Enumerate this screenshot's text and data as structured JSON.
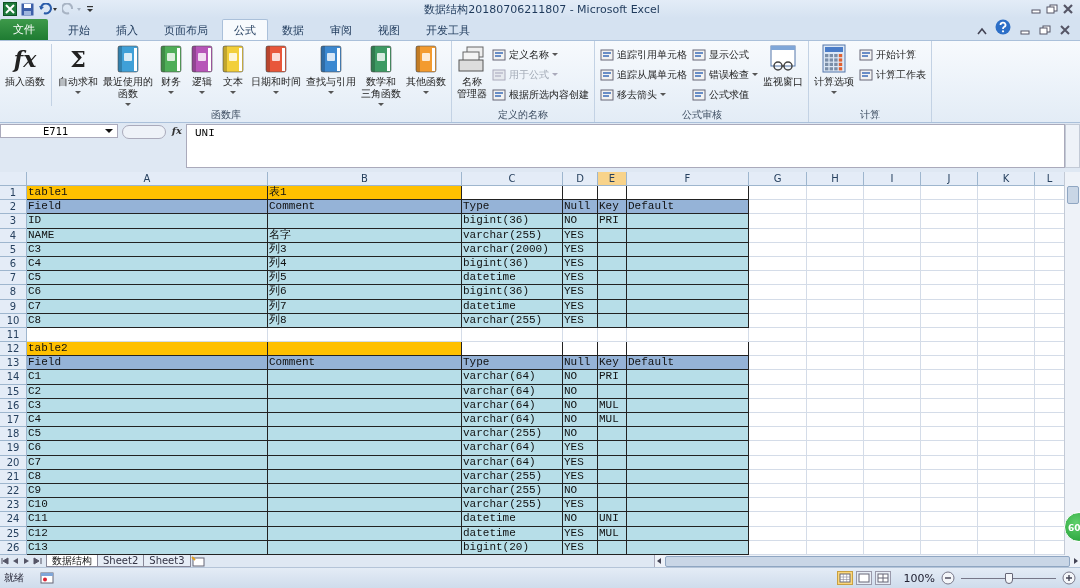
{
  "window": {
    "title": "数据结构20180706211807 - Microsoft Excel"
  },
  "tabs": [
    {
      "label": "文件",
      "kind": "file",
      "selected": false
    },
    {
      "label": "开始",
      "kind": "tab",
      "selected": false
    },
    {
      "label": "插入",
      "kind": "tab",
      "selected": false
    },
    {
      "label": "页面布局",
      "kind": "tab",
      "selected": false
    },
    {
      "label": "公式",
      "kind": "tab",
      "selected": true
    },
    {
      "label": "数据",
      "kind": "tab",
      "selected": false
    },
    {
      "label": "审阅",
      "kind": "tab",
      "selected": false
    },
    {
      "label": "视图",
      "kind": "tab",
      "selected": false
    },
    {
      "label": "开发工具",
      "kind": "tab",
      "selected": false
    }
  ],
  "ribbon": {
    "groups": [
      {
        "label": "函数库",
        "items": [
          {
            "kind": "big",
            "lines": [
              "插入函数"
            ],
            "glyph": "fx",
            "dropdown": false,
            "separator_after": true
          },
          {
            "kind": "big",
            "lines": [
              "自动求和"
            ],
            "glyph": "Σ",
            "dropdown": true
          },
          {
            "kind": "big",
            "lines": [
              "最近使用的",
              "函数"
            ],
            "dropdown": true
          },
          {
            "kind": "big",
            "lines": [
              "财务"
            ],
            "dropdown": true
          },
          {
            "kind": "big",
            "lines": [
              "逻辑"
            ],
            "dropdown": true
          },
          {
            "kind": "big",
            "lines": [
              "文本"
            ],
            "dropdown": true
          },
          {
            "kind": "big",
            "lines": [
              "日期和时间"
            ],
            "dropdown": true
          },
          {
            "kind": "big",
            "lines": [
              "查找与引用"
            ],
            "dropdown": true
          },
          {
            "kind": "big",
            "lines": [
              "数学和",
              "三角函数"
            ],
            "dropdown": true
          },
          {
            "kind": "big",
            "lines": [
              "其他函数"
            ],
            "dropdown": true
          }
        ]
      },
      {
        "label": "定义的名称",
        "items": [
          {
            "kind": "big",
            "lines": [
              "名称",
              "管理器"
            ],
            "dropdown": false
          },
          {
            "kind": "stack",
            "entries": [
              {
                "label": "定义名称",
                "dropdown": true,
                "disabled": false
              },
              {
                "label": "用于公式",
                "dropdown": true,
                "disabled": true
              },
              {
                "label": "根据所选内容创建",
                "dropdown": false,
                "disabled": false
              }
            ]
          }
        ]
      },
      {
        "label": "公式审核",
        "items": [
          {
            "kind": "stack",
            "entries": [
              {
                "label": "追踪引用单元格",
                "dropdown": false,
                "disabled": false
              },
              {
                "label": "追踪从属单元格",
                "dropdown": false,
                "disabled": false
              },
              {
                "label": "移去箭头",
                "dropdown": true,
                "disabled": false
              }
            ]
          },
          {
            "kind": "stack",
            "entries": [
              {
                "label": "显示公式",
                "dropdown": false,
                "disabled": false
              },
              {
                "label": "错误检查",
                "dropdown": true,
                "disabled": false
              },
              {
                "label": "公式求值",
                "dropdown": false,
                "disabled": false
              }
            ]
          },
          {
            "kind": "big",
            "lines": [
              "监视窗口"
            ],
            "dropdown": false
          }
        ]
      },
      {
        "label": "计算",
        "items": [
          {
            "kind": "big",
            "lines": [
              "计算选项"
            ],
            "dropdown": true
          },
          {
            "kind": "stack",
            "entries": [
              {
                "label": "开始计算",
                "dropdown": false,
                "disabled": false
              },
              {
                "label": "计算工作表",
                "dropdown": false,
                "disabled": false
              }
            ]
          }
        ]
      }
    ]
  },
  "formula_bar": {
    "name_box": "E711",
    "fx_label": "fx",
    "value": "UNI"
  },
  "sheet": {
    "columns": [
      {
        "letter": "A",
        "selected": false
      },
      {
        "letter": "B",
        "selected": false
      },
      {
        "letter": "C",
        "selected": false
      },
      {
        "letter": "D",
        "selected": false
      },
      {
        "letter": "E",
        "selected": true
      },
      {
        "letter": "F",
        "selected": false
      },
      {
        "letter": "G",
        "selected": false
      },
      {
        "letter": "H",
        "selected": false
      },
      {
        "letter": "I",
        "selected": false
      },
      {
        "letter": "J",
        "selected": false
      },
      {
        "letter": "K",
        "selected": false
      },
      {
        "letter": "L",
        "selected": false
      }
    ],
    "rows": [
      {
        "num": "1",
        "kind": "title",
        "cells": {
          "A": "table1",
          "B": "表1"
        }
      },
      {
        "num": "2",
        "kind": "header",
        "cells": {
          "A": "Field",
          "B": "Comment",
          "C": "Type",
          "D": "Null",
          "E": "Key",
          "F": "Default"
        }
      },
      {
        "num": "3",
        "kind": "data",
        "cells": {
          "A": "ID",
          "C": "bigint(36)",
          "D": "NO",
          "E": "PRI"
        }
      },
      {
        "num": "4",
        "kind": "data",
        "cells": {
          "A": "NAME",
          "B": "名字",
          "C": "varchar(255)",
          "D": "YES"
        }
      },
      {
        "num": "5",
        "kind": "data",
        "cells": {
          "A": "C3",
          "B": "列3",
          "C": "varchar(2000)",
          "D": "YES"
        }
      },
      {
        "num": "6",
        "kind": "data",
        "cells": {
          "A": "C4",
          "B": "列4",
          "C": "bigint(36)",
          "D": "YES"
        }
      },
      {
        "num": "7",
        "kind": "data",
        "cells": {
          "A": "C5",
          "B": "列5",
          "C": "datetime",
          "D": "YES"
        }
      },
      {
        "num": "8",
        "kind": "data",
        "cells": {
          "A": "C6",
          "B": "列6",
          "C": "bigint(36)",
          "D": "YES"
        }
      },
      {
        "num": "9",
        "kind": "data",
        "cells": {
          "A": "C7",
          "B": "列7",
          "C": "datetime",
          "D": "YES"
        }
      },
      {
        "num": "10",
        "kind": "data",
        "cells": {
          "A": "C8",
          "B": "列8",
          "C": "varchar(255)",
          "D": "YES"
        }
      },
      {
        "num": "11",
        "kind": "blank",
        "cells": {}
      },
      {
        "num": "12",
        "kind": "title",
        "cells": {
          "A": "table2"
        }
      },
      {
        "num": "13",
        "kind": "header",
        "cells": {
          "A": "Field",
          "B": "Comment",
          "C": "Type",
          "D": "Null",
          "E": "Key",
          "F": "Default"
        }
      },
      {
        "num": "14",
        "kind": "data",
        "cells": {
          "A": "C1",
          "C": "varchar(64)",
          "D": "NO",
          "E": "PRI"
        }
      },
      {
        "num": "15",
        "kind": "data",
        "cells": {
          "A": "C2",
          "C": "varchar(64)",
          "D": "NO"
        }
      },
      {
        "num": "16",
        "kind": "data",
        "cells": {
          "A": "C3",
          "C": "varchar(64)",
          "D": "NO",
          "E": "MUL"
        }
      },
      {
        "num": "17",
        "kind": "data",
        "cells": {
          "A": "C4",
          "C": "varchar(64)",
          "D": "NO",
          "E": "MUL"
        }
      },
      {
        "num": "18",
        "kind": "data",
        "cells": {
          "A": "C5",
          "C": "varchar(255)",
          "D": "NO"
        }
      },
      {
        "num": "19",
        "kind": "data",
        "cells": {
          "A": "C6",
          "C": "varchar(64)",
          "D": "YES"
        }
      },
      {
        "num": "20",
        "kind": "data",
        "cells": {
          "A": "C7",
          "C": "varchar(64)",
          "D": "YES"
        }
      },
      {
        "num": "21",
        "kind": "data",
        "cells": {
          "A": "C8",
          "C": "varchar(255)",
          "D": "YES"
        }
      },
      {
        "num": "22",
        "kind": "data",
        "cells": {
          "A": "C9",
          "C": "varchar(255)",
          "D": "NO"
        }
      },
      {
        "num": "23",
        "kind": "data",
        "cells": {
          "A": "C10",
          "C": "varchar(255)",
          "D": "YES"
        }
      },
      {
        "num": "24",
        "kind": "data",
        "cells": {
          "A": "C11",
          "C": "datetime",
          "D": "NO",
          "E": "UNI"
        }
      },
      {
        "num": "25",
        "kind": "data",
        "cells": {
          "A": "C12",
          "C": "datetime",
          "D": "YES",
          "E": "MUL"
        }
      },
      {
        "num": "26",
        "kind": "data",
        "cells": {
          "A": "C13",
          "C": "bigint(20)",
          "D": "YES"
        }
      }
    ]
  },
  "sheet_tabs": [
    {
      "label": "数据结构",
      "selected": true
    },
    {
      "label": "Sheet2",
      "selected": false
    },
    {
      "label": "Sheet3",
      "selected": false
    }
  ],
  "status_bar": {
    "status": "就绪",
    "zoom": "100%",
    "zoom_slider": {
      "level": 0.5
    },
    "views": [
      {
        "selected": true
      },
      {
        "selected": false
      },
      {
        "selected": false
      }
    ]
  },
  "overlay_badge": {
    "text": "60"
  }
}
